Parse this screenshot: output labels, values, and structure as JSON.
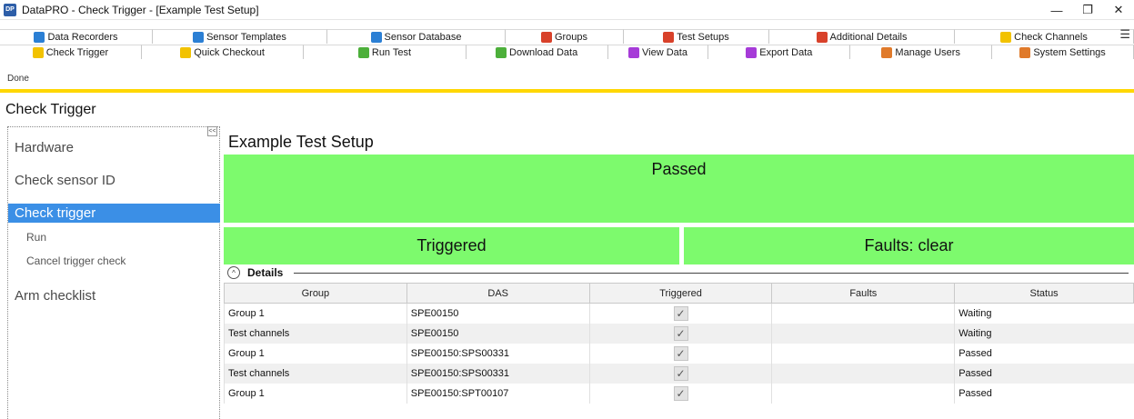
{
  "window": {
    "title": "DataPRO - Check Trigger - [Example Test Setup]",
    "icon_label": "DP",
    "minimize": "—",
    "restore": "❐",
    "close": "✕"
  },
  "tabs_row1": [
    {
      "label": "Data Recorders",
      "icon": "recorder-icon",
      "color": "#2b7fd4"
    },
    {
      "label": "Sensor Templates",
      "icon": "template-icon",
      "color": "#2b7fd4"
    },
    {
      "label": "Sensor Database",
      "icon": "database-icon",
      "color": "#2b7fd4"
    },
    {
      "label": "Groups",
      "icon": "groups-icon",
      "color": "#d8412a"
    },
    {
      "label": "Test Setups",
      "icon": "test-setups-icon",
      "color": "#d8412a"
    },
    {
      "label": "Additional Details",
      "icon": "details-icon",
      "color": "#d8412a"
    },
    {
      "label": "Check Channels",
      "icon": "check-channels-icon",
      "color": "#f2c200"
    }
  ],
  "tabs_row2": [
    {
      "label": "Check Trigger",
      "icon": "check-trigger-icon",
      "color": "#f2c200"
    },
    {
      "label": "Quick Checkout",
      "icon": "quick-checkout-icon",
      "color": "#f2c200"
    },
    {
      "label": "Run Test",
      "icon": "run-test-icon",
      "color": "#4caf3a"
    },
    {
      "label": "Download Data",
      "icon": "download-icon",
      "color": "#4caf3a"
    },
    {
      "label": "View Data",
      "icon": "view-data-icon",
      "color": "#a63bd8"
    },
    {
      "label": "Export Data",
      "icon": "export-icon",
      "color": "#a63bd8"
    },
    {
      "label": "Manage Users",
      "icon": "users-icon",
      "color": "#e07a2a"
    },
    {
      "label": "System Settings",
      "icon": "settings-icon",
      "color": "#e07a2a"
    }
  ],
  "tab_menu": "☰",
  "status": "Done",
  "page_heading": "Check Trigger",
  "sidebar": {
    "collapse": "<<",
    "items": [
      "Hardware",
      "Check sensor ID",
      "Check trigger",
      "Arm checklist"
    ],
    "sub_items": [
      "Run",
      "Cancel trigger check"
    ]
  },
  "main": {
    "setup_title": "Example Test Setup",
    "overall_status": "Passed",
    "trigger_status": "Triggered",
    "faults_status": "Faults: clear",
    "details_toggle": "^",
    "details_label": "Details"
  },
  "table": {
    "columns": [
      "Group",
      "DAS",
      "Triggered",
      "Faults",
      "Status"
    ],
    "check_glyph": "✓",
    "rows": [
      {
        "group": "Group 1",
        "das": "SPE00150",
        "triggered": true,
        "faults": "",
        "status": "Waiting"
      },
      {
        "group": "Test channels",
        "das": "SPE00150",
        "triggered": true,
        "faults": "",
        "status": "Waiting"
      },
      {
        "group": "Group 1",
        "das": "SPE00150:SPS00331",
        "triggered": true,
        "faults": "",
        "status": "Passed"
      },
      {
        "group": "Test channels",
        "das": "SPE00150:SPS00331",
        "triggered": true,
        "faults": "",
        "status": "Passed"
      },
      {
        "group": "Group 1",
        "das": "SPE00150:SPT00107",
        "triggered": true,
        "faults": "",
        "status": "Passed"
      }
    ]
  }
}
